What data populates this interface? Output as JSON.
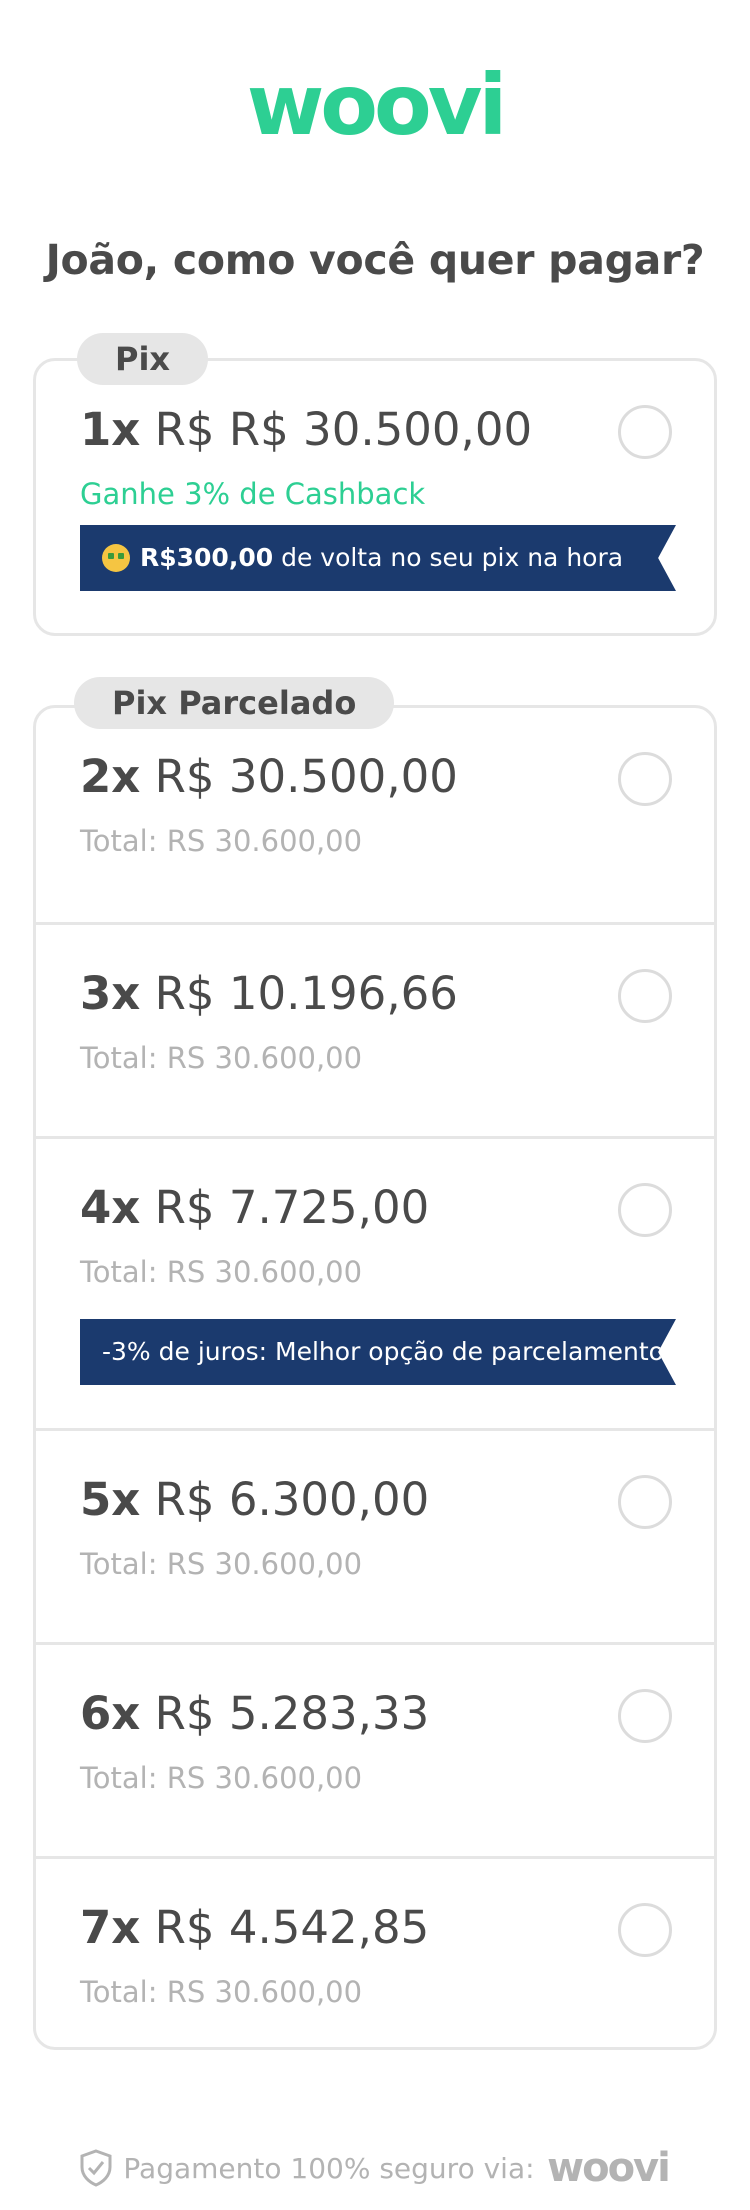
{
  "brand": {
    "name": "woovi",
    "color": "#2dcf93",
    "footer_color": "#b3b3b3"
  },
  "headline": "João, como você quer pagar?",
  "pix": {
    "label": "Pix",
    "option": {
      "count": "1x",
      "amount": "R$ R$ 30.500,00",
      "cashback": "Ganhe 3% de Cashback",
      "banner_strong": "R$300,00",
      "banner_text": " de volta no seu pix na hora",
      "banner_icon": "money-mouth-face-emoji",
      "selected": false
    }
  },
  "parcelado": {
    "label": "Pix Parcelado",
    "options": [
      {
        "count": "2x",
        "amount": "R$ 30.500,00",
        "total": "Total: RS 30.600,00",
        "selected": false
      },
      {
        "count": "3x",
        "amount": "R$ 10.196,66",
        "total": "Total: RS 30.600,00",
        "selected": false
      },
      {
        "count": "4x",
        "amount": "R$ 7.725,00",
        "total": "Total: RS 30.600,00",
        "banner": "-3% de juros: Melhor opção de parcelamento",
        "selected": false
      },
      {
        "count": "5x",
        "amount": "R$ 6.300,00",
        "total": "Total: RS 30.600,00",
        "selected": false
      },
      {
        "count": "6x",
        "amount": "R$ 5.283,33",
        "total": "Total: RS 30.600,00",
        "selected": false
      },
      {
        "count": "7x",
        "amount": "R$ 4.542,85",
        "total": "Total: RS 30.600,00",
        "selected": false
      }
    ]
  },
  "footer": {
    "text": "Pagamento 100% seguro via:",
    "logo": "woovi",
    "icon": "shield-check-icon"
  },
  "colors": {
    "banner_bg": "#1b3a6e",
    "radio_border": "#dcdcdc",
    "card_border": "#e6e6e6"
  }
}
